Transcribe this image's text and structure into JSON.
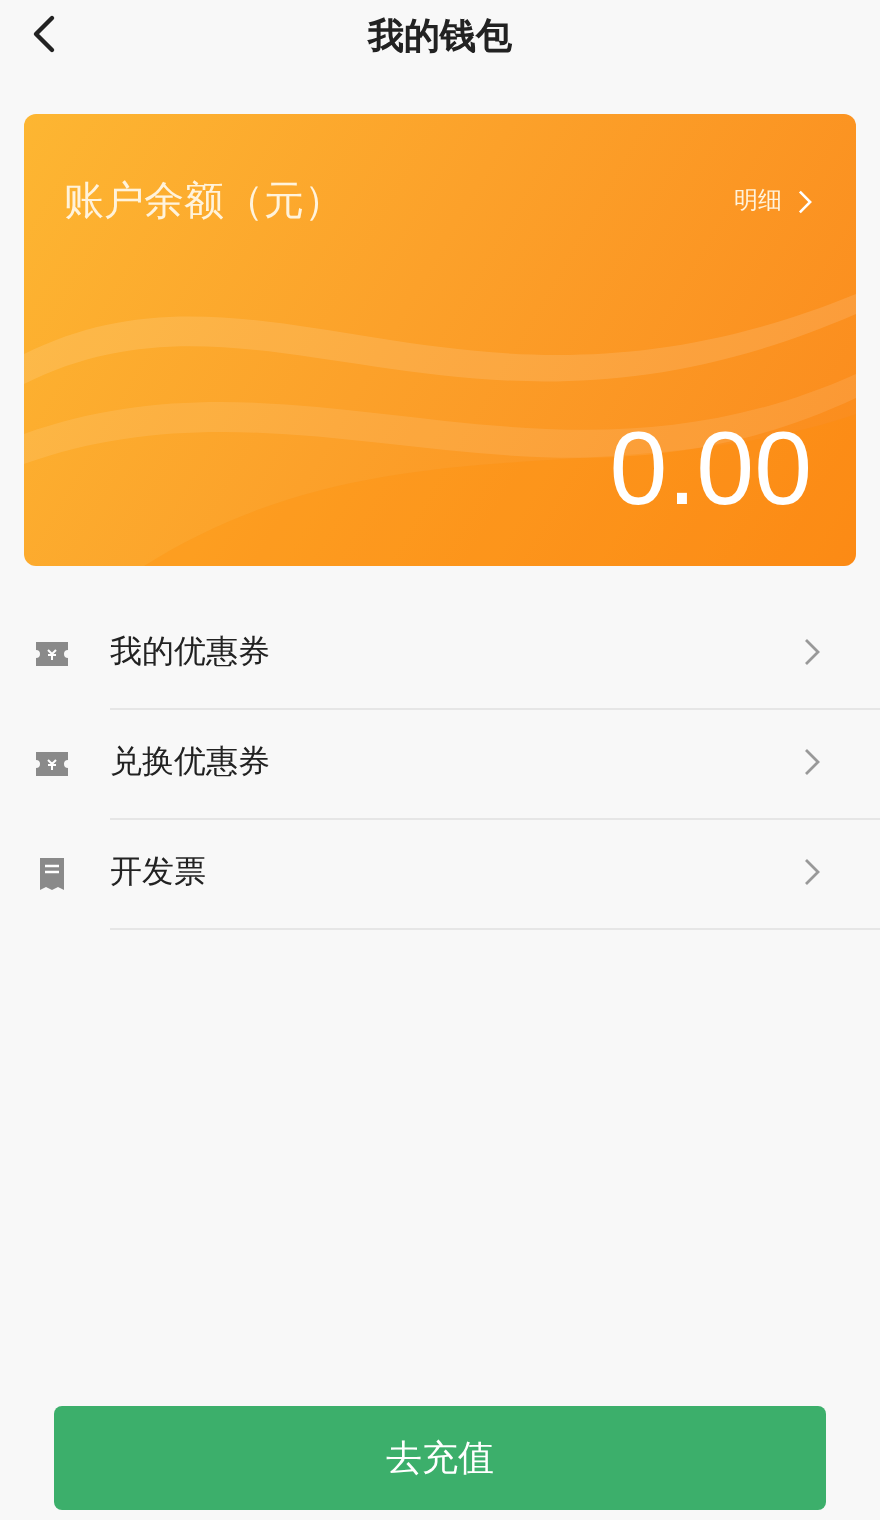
{
  "header": {
    "title": "我的钱包"
  },
  "balance_card": {
    "label": "账户余额（元）",
    "details_link": "明细",
    "amount": "0.00"
  },
  "menu": [
    {
      "label": "我的优惠券",
      "kind": "ticket"
    },
    {
      "label": "兑换优惠券",
      "kind": "ticket"
    },
    {
      "label": "开发票",
      "kind": "receipt"
    }
  ],
  "recharge_button": "去充值"
}
